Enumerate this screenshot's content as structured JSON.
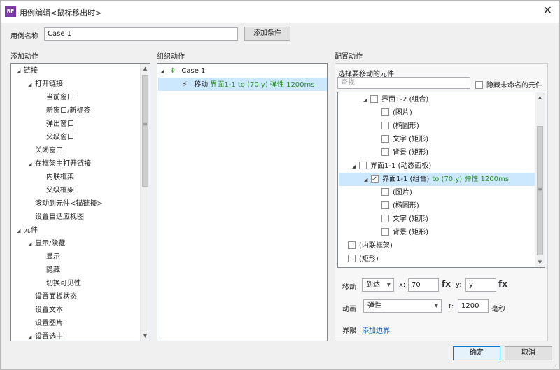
{
  "window": {
    "title": "用例编辑<鼠标移出时>",
    "app_icon_text": "RP"
  },
  "case_name": {
    "label": "用例名称",
    "value": "Case 1",
    "add_condition_label": "添加条件"
  },
  "add_actions": {
    "title": "添加动作",
    "items": [
      {
        "label": "链接",
        "level": 0,
        "expanded": true
      },
      {
        "label": "打开链接",
        "level": 1,
        "expanded": true
      },
      {
        "label": "当前窗口",
        "level": 2
      },
      {
        "label": "新窗口/新标签",
        "level": 2
      },
      {
        "label": "弹出窗口",
        "level": 2
      },
      {
        "label": "父级窗口",
        "level": 2
      },
      {
        "label": "关闭窗口",
        "level": 1
      },
      {
        "label": "在框架中打开链接",
        "level": 1,
        "expanded": true
      },
      {
        "label": "内联框架",
        "level": 2
      },
      {
        "label": "父级框架",
        "level": 2
      },
      {
        "label": "滚动到元件<锚链接>",
        "level": 1
      },
      {
        "label": "设置自适应视图",
        "level": 1
      },
      {
        "label": "元件",
        "level": 0,
        "expanded": true
      },
      {
        "label": "显示/隐藏",
        "level": 1,
        "expanded": true
      },
      {
        "label": "显示",
        "level": 2
      },
      {
        "label": "隐藏",
        "level": 2
      },
      {
        "label": "切换可见性",
        "level": 2
      },
      {
        "label": "设置面板状态",
        "level": 1
      },
      {
        "label": "设置文本",
        "level": 1
      },
      {
        "label": "设置图片",
        "level": 1
      },
      {
        "label": "设置选中",
        "level": 1,
        "expanded": true
      }
    ]
  },
  "organize_actions": {
    "title": "组织动作",
    "case_label": "Case 1",
    "action_prefix": "移动",
    "action_detail": "界面1-1 to (70,y) 弹性 1200ms"
  },
  "configure_actions": {
    "title": "配置动作",
    "select_widget_label": "选择要移动的元件",
    "search_placeholder": "查找",
    "hide_unnamed_label": "隐藏未命名的元件",
    "tree": [
      {
        "label": "界面1-2 (组合)",
        "indent": 0,
        "expander": true,
        "checked": false
      },
      {
        "label": "(图片)",
        "indent": 1,
        "checked": false
      },
      {
        "label": "(椭圆形)",
        "indent": 1,
        "checked": false
      },
      {
        "label": "文字 (矩形)",
        "indent": 1,
        "checked": false
      },
      {
        "label": "背景 (矩形)",
        "indent": 1,
        "checked": false
      },
      {
        "label": "界面1-1 (动态面板)",
        "indent": -1,
        "expander": true,
        "checked": false
      },
      {
        "label": "界面1-1 (组合)",
        "detail": "to (70,y) 弹性 1200ms",
        "indent": 0,
        "expander": true,
        "checked": true,
        "selected": true
      },
      {
        "label": "(图片)",
        "indent": 1,
        "checked": false
      },
      {
        "label": "(椭圆形)",
        "indent": 1,
        "checked": false
      },
      {
        "label": "文字 (矩形)",
        "indent": 1,
        "checked": false
      },
      {
        "label": "背景 (矩形)",
        "indent": 1,
        "checked": false
      },
      {
        "label": "(内联框架)",
        "indent": -2,
        "checked": false
      },
      {
        "label": "(矩形)",
        "indent": -2,
        "checked": false
      }
    ],
    "move": {
      "label": "移动",
      "mode": "到达",
      "x_label": "x:",
      "x_value": "70",
      "y_label": "y:",
      "y_value": "y",
      "fx": "fx"
    },
    "animation": {
      "label": "动画",
      "value": "弹性",
      "t_label": "t:",
      "t_value": "1200",
      "unit": "毫秒"
    },
    "bounds": {
      "label": "界限",
      "link": "添加边界"
    }
  },
  "footer": {
    "ok_label": "确定",
    "cancel_label": "取消"
  }
}
